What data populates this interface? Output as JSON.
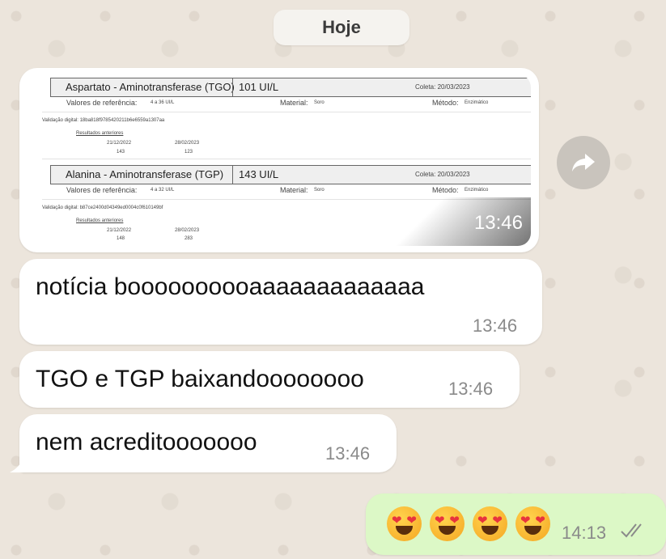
{
  "date_chip": "Hoje",
  "image_message": {
    "time": "13:46",
    "tests": [
      {
        "name": "Aspartato - Aminotransferase (TGO)",
        "value": "101 UI/L",
        "coleta": "Coleta: 20/03/2023",
        "ref_label": "Valores de referência:",
        "ref_value": "4 a 36 UI/L",
        "material_label": "Material:",
        "material_value": "Soro",
        "metodo_label": "Método:",
        "metodo_value": "Enzimático",
        "validation": "Validação digital: 18ba818f9785420211b6e6559a1307aa",
        "previous_label": "Resultados anteriores",
        "prev_dates": [
          "21/12/2022",
          "28/02/2023"
        ],
        "prev_values": [
          "143",
          "123"
        ]
      },
      {
        "name": "Alanina - Aminotransferase (TGP)",
        "value": "143 UI/L",
        "coleta": "Coleta: 20/03/2023",
        "ref_label": "Valores de referência:",
        "ref_value": "4 a 32 UI/L",
        "material_label": "Material:",
        "material_value": "Soro",
        "metodo_label": "Método:",
        "metodo_value": "Enzimático",
        "validation": "Validação digital: b87ce2400d04349ed0004c0f610149bf",
        "previous_label": "Resultados anteriores",
        "prev_dates": [
          "21/12/2022",
          "28/02/2023"
        ],
        "prev_values": [
          "148",
          "283"
        ]
      }
    ]
  },
  "messages": [
    {
      "text": "notícia boooooooooaaaaaaaaaaaaa",
      "time": "13:46",
      "direction": "incoming"
    },
    {
      "text": "TGO e TGP baixandoooooooo",
      "time": "13:46",
      "direction": "incoming"
    },
    {
      "text": "nem acreditooooooo",
      "time": "13:46",
      "direction": "incoming"
    }
  ],
  "outgoing": {
    "emojis": [
      "heart-eyes",
      "heart-eyes",
      "heart-eyes",
      "heart-eyes"
    ],
    "time": "14:13",
    "status": "read"
  },
  "colors": {
    "wallpaper": "#ece5dc",
    "incoming_bubble": "#ffffff",
    "outgoing_bubble": "#dcf8c6",
    "read_ticks": "#8a8a8a"
  }
}
